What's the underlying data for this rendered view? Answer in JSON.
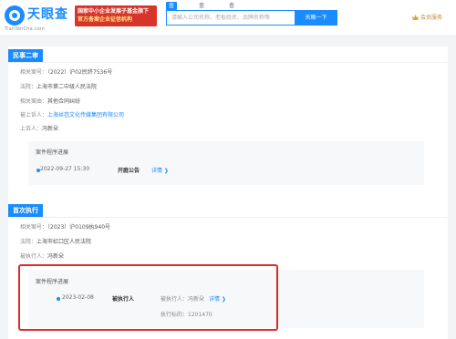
{
  "header": {
    "logo_text": "天眼查",
    "logo_domain": "TianYanCha.com",
    "promo_line1": "国家中小企业发展子基金旗下",
    "promo_line2": "官方备案企业征信机构",
    "search_tabs": [
      "查公司",
      "查老板",
      "查关系"
    ],
    "search_placeholder": "请输入公司名称、老板姓名、品牌名称等",
    "search_button": "天眼一下",
    "vip_label": "会员服务"
  },
  "case1": {
    "tag": "民事二审",
    "fields": [
      {
        "k": "相关案号：",
        "v": "（2022）沪02民终7536号",
        "link": false
      },
      {
        "k": "法院：",
        "v": "上海市第二中级人民法院",
        "link": false
      },
      {
        "k": "相关案由：",
        "v": "其他合同纠纷",
        "link": false
      },
      {
        "k": "被上诉人：",
        "v": "上海丝芭文化传媒集团有限公司",
        "link": true
      },
      {
        "k": "上诉人：",
        "v": "冯新朵",
        "link": false
      }
    ],
    "process_title": "案件程序进展",
    "process": {
      "date": "2022-09-27 15:30",
      "stage": "开庭公告",
      "detail": "详情 ❯"
    }
  },
  "case2": {
    "tag": "首次执行",
    "fields": [
      {
        "k": "相关案号：",
        "v": "（2023）沪0109执940号",
        "link": false
      },
      {
        "k": "法院：",
        "v": "上海市虹口区人民法院",
        "link": false
      },
      {
        "k": "被执行人：",
        "v": "冯新朵",
        "link": false
      }
    ],
    "process_title": "案件程序进展",
    "process": {
      "date": "2023-02-08",
      "stage": "被执行人",
      "party": "被执行人：冯新朵",
      "detail": "详情 ❯",
      "amount": "执行标的：1201470"
    }
  }
}
